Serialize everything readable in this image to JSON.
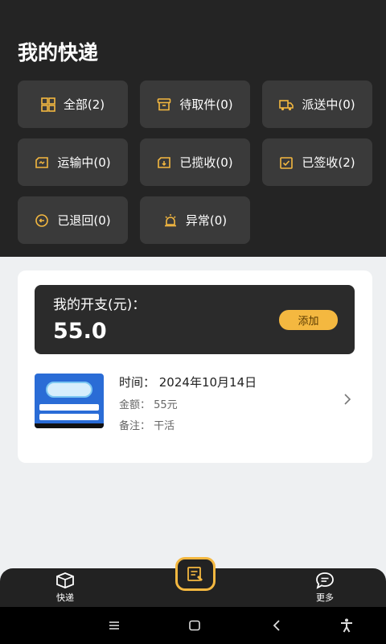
{
  "header": {
    "title": "我的快递"
  },
  "categories": [
    {
      "label": "全部(2)",
      "icon": "grid-icon"
    },
    {
      "label": "待取件(0)",
      "icon": "box-icon"
    },
    {
      "label": "派送中(0)",
      "icon": "truck-icon"
    },
    {
      "label": "运输中(0)",
      "icon": "transit-icon"
    },
    {
      "label": "已揽收(0)",
      "icon": "collected-icon"
    },
    {
      "label": "已签收(2)",
      "icon": "signed-icon"
    },
    {
      "label": "已退回(0)",
      "icon": "returned-icon"
    },
    {
      "label": "异常(0)",
      "icon": "alert-icon"
    }
  ],
  "expense": {
    "label": "我的开支(元)：",
    "value": "55.0",
    "add_label": "添加"
  },
  "record": {
    "time": "时间：  2024年10月14日",
    "amount": "金额：  55元",
    "note": "备注：  干活"
  },
  "tabs": {
    "express": "快递",
    "more": "更多"
  },
  "colors": {
    "accent": "#f4b840",
    "header_bg": "#242424",
    "chip_bg": "#3a3a3a"
  }
}
